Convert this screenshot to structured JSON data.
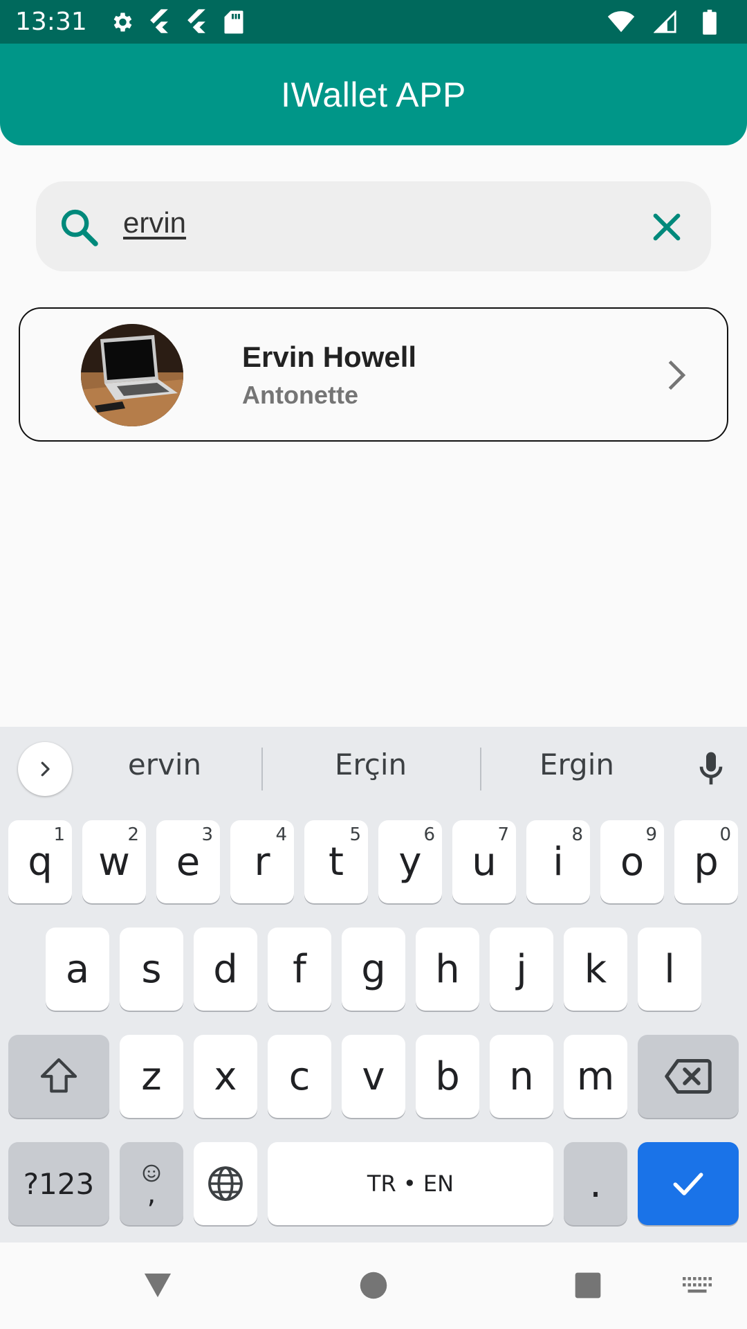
{
  "status_bar": {
    "time": "13:31",
    "left_icons": [
      "gear-icon",
      "flutter-icon",
      "flutter-icon",
      "sd-card-icon"
    ],
    "right_icons": [
      "wifi-icon",
      "signal-icon",
      "battery-icon"
    ]
  },
  "app_bar": {
    "title": "IWallet APP"
  },
  "search": {
    "value": "ervin"
  },
  "results": [
    {
      "name": "Ervin Howell",
      "username": "Antonette"
    }
  ],
  "keyboard": {
    "suggestions": [
      "ervin",
      "Erçin",
      "Ergin"
    ],
    "row1": [
      {
        "label": "q",
        "hint": "1"
      },
      {
        "label": "w",
        "hint": "2"
      },
      {
        "label": "e",
        "hint": "3"
      },
      {
        "label": "r",
        "hint": "4"
      },
      {
        "label": "t",
        "hint": "5"
      },
      {
        "label": "y",
        "hint": "6"
      },
      {
        "label": "u",
        "hint": "7"
      },
      {
        "label": "i",
        "hint": "8"
      },
      {
        "label": "o",
        "hint": "9"
      },
      {
        "label": "p",
        "hint": "0"
      }
    ],
    "row2": [
      "a",
      "s",
      "d",
      "f",
      "g",
      "h",
      "j",
      "k",
      "l"
    ],
    "row3": [
      "z",
      "x",
      "c",
      "v",
      "b",
      "n",
      "m"
    ],
    "symbols_label": "?123",
    "emoji_comma_label": ",",
    "space_label": "TR • EN",
    "period_label": "."
  },
  "colors": {
    "status_bar": "#00695C",
    "app_bar": "#009688",
    "accent": "#00897B",
    "enter_key": "#1A73E8"
  }
}
